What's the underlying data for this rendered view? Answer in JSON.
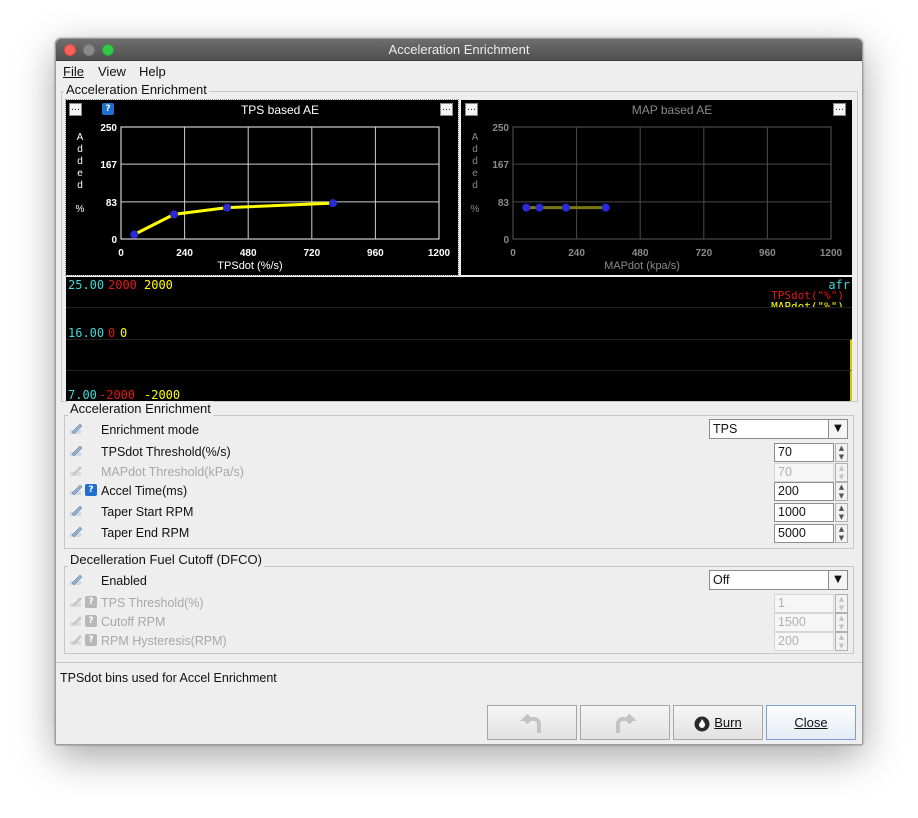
{
  "window": {
    "title": "Acceleration Enrichment"
  },
  "menu": {
    "file": "File",
    "view": "View",
    "help": "Help"
  },
  "top_group": {
    "title": "Acceleration Enrichment"
  },
  "chart_data": [
    {
      "type": "line",
      "title": "TPS based AE",
      "xlabel": "TPSdot (%/s)",
      "ylabel": "A d d e d  %",
      "x_ticks": [
        "0",
        "240",
        "480",
        "720",
        "960",
        "1200"
      ],
      "y_ticks": [
        "250",
        "167",
        "83",
        "0"
      ],
      "xlim": [
        0,
        1200
      ],
      "ylim": [
        0,
        250
      ],
      "series": [
        {
          "x": [
            50,
            200,
            400,
            800
          ],
          "y": [
            10,
            55,
            70,
            80
          ],
          "color": "#ffff00",
          "point_color": "#2a2ad8"
        }
      ]
    },
    {
      "type": "line",
      "title": "MAP based AE",
      "xlabel": "MAPdot (kpa/s)",
      "ylabel": "A d d e d  %",
      "x_ticks": [
        "0",
        "240",
        "480",
        "720",
        "960",
        "1200"
      ],
      "y_ticks": [
        "250",
        "167",
        "83",
        "0"
      ],
      "xlim": [
        0,
        1200
      ],
      "ylim": [
        0,
        250
      ],
      "series": [
        {
          "x": [
            50,
            100,
            200,
            350
          ],
          "y": [
            70,
            70,
            70,
            70
          ],
          "color": "#7a7a10",
          "point_color": "#2a2ad8"
        }
      ]
    }
  ],
  "strip": {
    "top": {
      "afr": "25.00",
      "tps": "2000",
      "map": "2000"
    },
    "mid": {
      "afr": "16.00",
      "tps": "0",
      "map": "0"
    },
    "bottom": {
      "afr": "7.00",
      "tps": "-2000",
      "map": "-2000"
    },
    "legend": {
      "afr": "afr",
      "tps": "TPSdot(\"%\")",
      "map": "MAPdot(\"%\")"
    },
    "colors": {
      "afr": "#40d8d8",
      "tps": "#e01818",
      "map": "#ffff00"
    }
  },
  "ae_group": {
    "title": "Acceleration Enrichment",
    "enrichment_mode": {
      "label": "Enrichment mode",
      "value": "TPS"
    },
    "tpsdot_threshold": {
      "label": "TPSdot Threshold(%/s)",
      "value": "70"
    },
    "mapdot_threshold": {
      "label": "MAPdot Threshold(kPa/s)",
      "value": "70"
    },
    "accel_time": {
      "label": "Accel Time(ms)",
      "value": "200"
    },
    "taper_start": {
      "label": "Taper Start RPM",
      "value": "1000"
    },
    "taper_end": {
      "label": "Taper End RPM",
      "value": "5000"
    }
  },
  "dfco_group": {
    "title": "Decelleration Fuel Cutoff (DFCO)",
    "enabled": {
      "label": "Enabled",
      "value": "Off"
    },
    "tps_threshold": {
      "label": "TPS Threshold(%)",
      "value": "1"
    },
    "cutoff_rpm": {
      "label": "Cutoff RPM",
      "value": "1500"
    },
    "rpm_hysteresis": {
      "label": "RPM Hysteresis(RPM)",
      "value": "200"
    }
  },
  "status": {
    "text": "TPSdot bins used for Accel Enrichment"
  },
  "buttons": {
    "burn": "Burn",
    "close": "Close"
  }
}
